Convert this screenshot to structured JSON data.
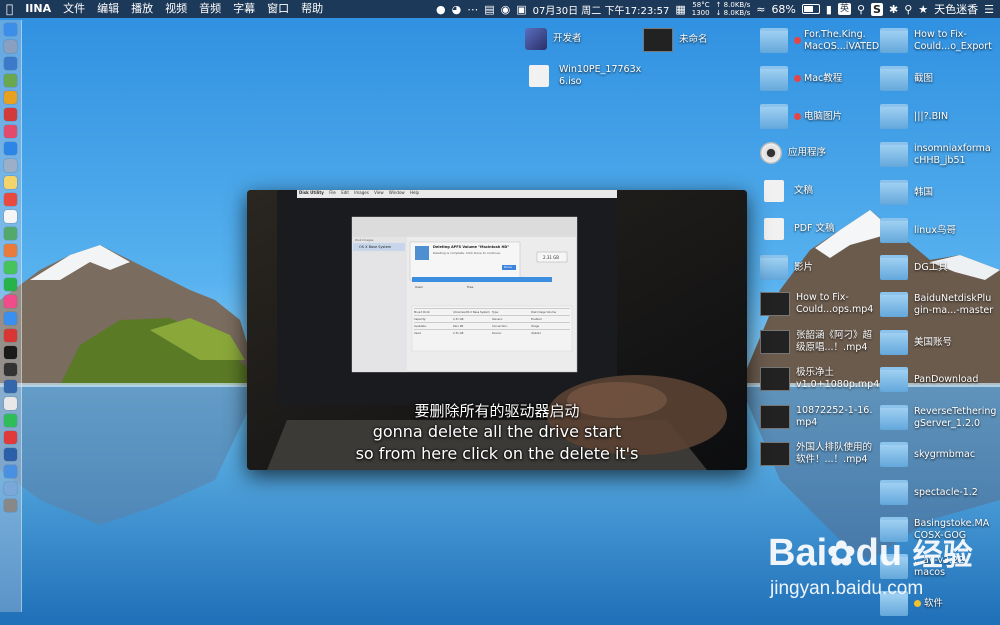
{
  "menubar": {
    "app_name": "IINA",
    "menus": [
      "文件",
      "编辑",
      "播放",
      "视频",
      "音频",
      "字幕",
      "窗口",
      "帮助"
    ],
    "datetime": "07月30日 周二 下午17:23:57",
    "sensors": [
      "58°C",
      "1300"
    ],
    "net": [
      "↑ 8.0KB/s",
      "↓ 8.0KB/s"
    ],
    "battery": "68%",
    "battery_level": 0.68,
    "ime": "英",
    "user": "天色迷香"
  },
  "desktop": {
    "items": [
      {
        "label": "开发者",
        "icon": "xcode-app-icon",
        "type": "app"
      },
      {
        "label": "未命名",
        "icon": "video-thumbnail",
        "type": "video"
      },
      {
        "label": "Win10PE_17763x\n6.iso",
        "icon": "disk-image-icon",
        "type": "file"
      },
      {
        "label": "For.The.King.\nMacOS...iVATED",
        "tag": "red",
        "type": "folder"
      },
      {
        "label": "Mac教程",
        "tag": "red",
        "type": "folder"
      },
      {
        "label": "电脑图片",
        "tag": "red",
        "type": "folder"
      },
      {
        "label": "应用程序",
        "icon": "hard-drive-icon",
        "type": "drive"
      },
      {
        "label": "文稿",
        "type": "file"
      },
      {
        "label": "PDF 文稿",
        "type": "file"
      },
      {
        "label": "影片",
        "type": "folder"
      },
      {
        "label": "How to Fix-\nCould...ops.mp4",
        "type": "video"
      },
      {
        "label": "张韶涵《阿刁》超\n级原唱...！.mp4",
        "type": "video"
      },
      {
        "label": "极乐净土\nv1.0+1080p.mp4",
        "type": "video"
      },
      {
        "label": "10872252-1-16.\nmp4",
        "type": "video"
      },
      {
        "label": "外国人排队使用的\n软件！...！.mp4",
        "type": "video"
      },
      {
        "label": "How to Fix-\nCould...o_Export",
        "type": "folder"
      },
      {
        "label": "截图",
        "type": "folder"
      },
      {
        "label": "|||?.BIN",
        "type": "folder"
      },
      {
        "label": "insomniaxforma\ncHHB_jb51",
        "type": "folder"
      },
      {
        "label": "韩国",
        "type": "folder"
      },
      {
        "label": "linux鸟哥",
        "type": "folder"
      },
      {
        "label": "DG工具",
        "type": "folder"
      },
      {
        "label": "BaiduNetdiskPlu\ngin-ma...-master",
        "type": "folder"
      },
      {
        "label": "美国账号",
        "type": "folder"
      },
      {
        "label": "PanDownload",
        "type": "folder"
      },
      {
        "label": "ReverseTethering\ngServer_1.2.0",
        "type": "folder"
      },
      {
        "label": "skygrmbmac",
        "type": "folder"
      },
      {
        "label": "spectacle-1.2",
        "type": "folder"
      },
      {
        "label": "Basingstoke.MA\nCOSX-GOG",
        "type": "folder"
      },
      {
        "label": "...ay-v3.22-\nmacos",
        "type": "folder"
      },
      {
        "label": "软件",
        "tag": "yellow",
        "type": "folder"
      }
    ]
  },
  "player": {
    "subtitle_lines": [
      "要删除所有的驱动器启动",
      "gonna delete all the drive start",
      "so from here click on the delete it's"
    ],
    "video_menubar": [
      "Disk Utility",
      "File",
      "Edit",
      "Images",
      "View",
      "Window",
      "Help"
    ],
    "dialog_title": "Deleting APFS Volume \"Macintosh HD\"",
    "dialog_sub": "Deleting is complete. Click Done to continue.",
    "dialog_button": "Done",
    "sidebar_header": "Disk Images",
    "sidebar_item": "OS X Base System",
    "capacity": "2.31 GB",
    "used_label": "Used",
    "free_label": "Free",
    "info_rows": [
      [
        "Mount Point:",
        "/Volumes/OS X Base System",
        "Type:",
        "Disk Image Volume"
      ],
      [
        "Capacity:",
        "2.31 GB",
        "Owners:",
        "Enabled"
      ],
      [
        "Available:",
        "Zero KB",
        "Connection:",
        "Image"
      ],
      [
        "Used:",
        "2.31 GB",
        "Device:",
        "disk2s1"
      ]
    ]
  },
  "watermark": {
    "brand_left": "Bai",
    "brand_mid": "du",
    "brand_cn": "经验",
    "url": "jingyan.baidu.com"
  },
  "dock": {
    "icons": [
      "finder-icon",
      "launchpad-icon",
      "safari-icon",
      "android-icon",
      "chrome-icon",
      "red-app-icon",
      "music-icon",
      "app-store-icon",
      "preview-icon",
      "notes-icon",
      "calendar-icon",
      "reminders-icon",
      "maps-icon",
      "photos-icon",
      "messages-icon",
      "wechat-icon",
      "itunes-icon",
      "appstore-icon",
      "vivaldi-icon",
      "terminal-icon",
      "console-icon",
      "vpn-icon",
      "yandex-icon",
      "wechat-2-icon",
      "weibo-icon",
      "qq-music-icon",
      "downloads-icon",
      "folder-icon",
      "trash-icon"
    ]
  }
}
